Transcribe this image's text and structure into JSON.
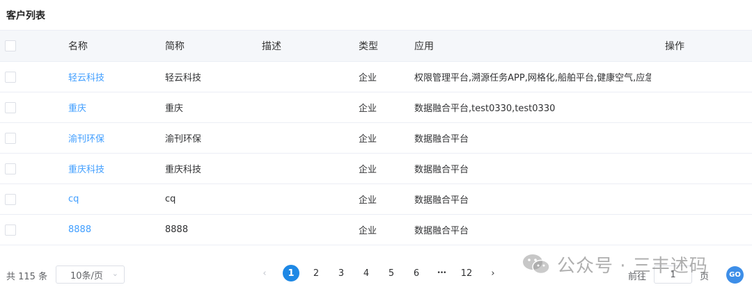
{
  "page": {
    "title": "客户列表"
  },
  "table": {
    "headers": {
      "name": "名称",
      "short": "简称",
      "desc": "描述",
      "type": "类型",
      "apps": "应用",
      "ops": "操作"
    },
    "rows": [
      {
        "name": "轻云科技",
        "short": "轻云科技",
        "desc": "",
        "type": "企业",
        "apps": "权限管理平台,溯源任务APP,网格化,船舶平台,健康空气,应急指..."
      },
      {
        "name": "重庆",
        "short": "重庆",
        "desc": "",
        "type": "企业",
        "apps": "数据融合平台,test0330,test0330"
      },
      {
        "name": "渝刊环保",
        "short": "渝刊环保",
        "desc": "",
        "type": "企业",
        "apps": "数据融合平台"
      },
      {
        "name": "重庆科技",
        "short": "重庆科技",
        "desc": "",
        "type": "企业",
        "apps": "数据融合平台"
      },
      {
        "name": "cq",
        "short": "cq",
        "desc": "",
        "type": "企业",
        "apps": "数据融合平台"
      },
      {
        "name": "8888",
        "short": "8888",
        "desc": "",
        "type": "企业",
        "apps": "数据融合平台"
      }
    ]
  },
  "pagination": {
    "total_text": "共 115 条",
    "page_size": "10条/页",
    "prev": "‹",
    "pages": [
      "1",
      "2",
      "3",
      "4",
      "5",
      "6"
    ],
    "ellipsis": "•••",
    "last": "12",
    "next": "›",
    "jump_prefix": "前往",
    "jump_value": "1",
    "jump_suffix": "页",
    "go": "GO"
  },
  "watermark": {
    "text": "公众号 · 三丰述码"
  },
  "colors": {
    "link": "#409eff",
    "active_page": "#1e88e5",
    "header_bg": "#f5f7fa"
  }
}
